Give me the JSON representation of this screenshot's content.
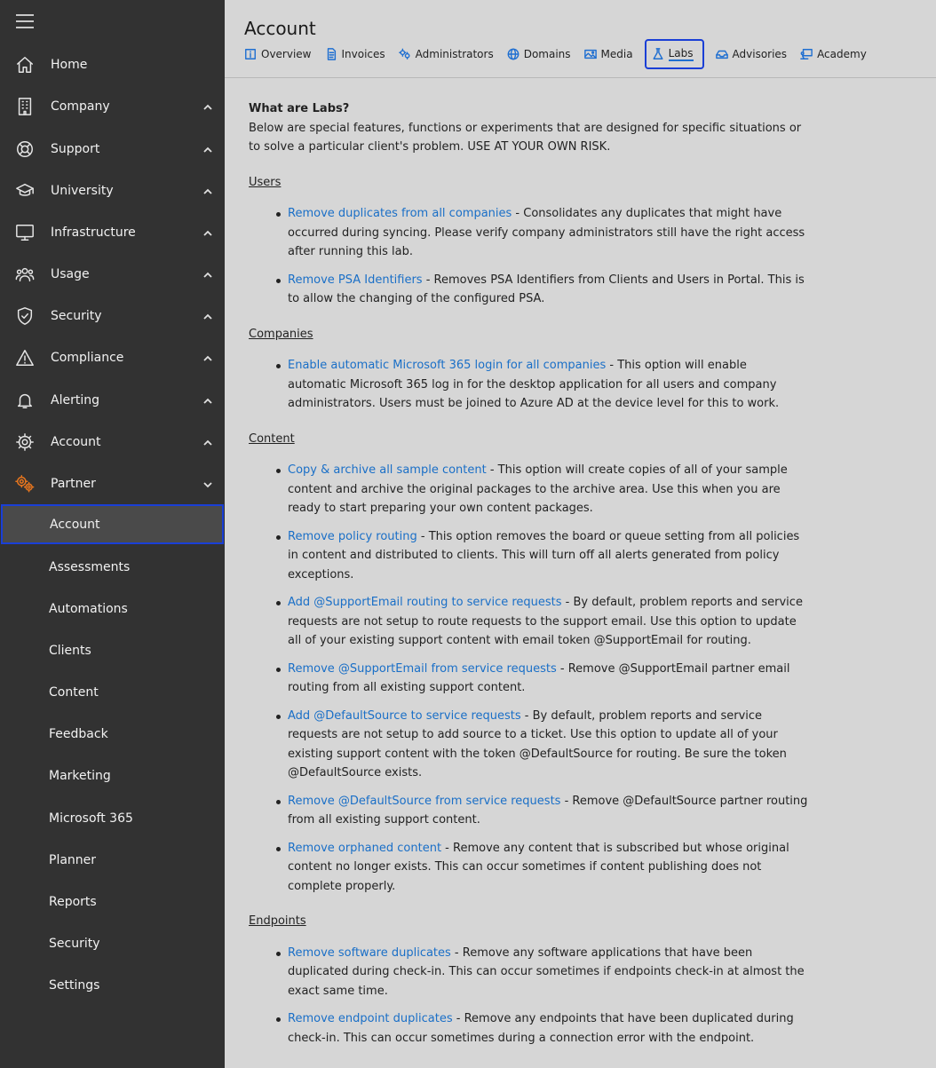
{
  "sidebar": {
    "nav": [
      {
        "label": "Home",
        "icon": "home-icon",
        "chevron": ""
      },
      {
        "label": "Company",
        "icon": "building-icon",
        "chevron": "up"
      },
      {
        "label": "Support",
        "icon": "lifebuoy-icon",
        "chevron": "up"
      },
      {
        "label": "University",
        "icon": "graduation-cap-icon",
        "chevron": "up"
      },
      {
        "label": "Infrastructure",
        "icon": "monitor-icon",
        "chevron": "up"
      },
      {
        "label": "Usage",
        "icon": "users-icon",
        "chevron": "up"
      },
      {
        "label": "Security",
        "icon": "shield-icon",
        "chevron": "up"
      },
      {
        "label": "Compliance",
        "icon": "warning-icon",
        "chevron": "up"
      },
      {
        "label": "Alerting",
        "icon": "bell-icon",
        "chevron": "up"
      },
      {
        "label": "Account",
        "icon": "gear-icon",
        "chevron": "up"
      },
      {
        "label": "Partner",
        "icon": "partner-gears-icon",
        "chevron": "down"
      }
    ],
    "sub_items": [
      "Account",
      "Assessments",
      "Automations",
      "Clients",
      "Content",
      "Feedback",
      "Marketing",
      "Microsoft 365",
      "Planner",
      "Reports",
      "Security",
      "Settings"
    ],
    "active_sub": "Account",
    "partner_icon_color": "#e8761e"
  },
  "header": {
    "title": "Account",
    "tabs": [
      {
        "label": "Overview",
        "icon": "info-icon"
      },
      {
        "label": "Invoices",
        "icon": "invoice-icon"
      },
      {
        "label": "Administrators",
        "icon": "admins-icon"
      },
      {
        "label": "Domains",
        "icon": "globe-icon"
      },
      {
        "label": "Media",
        "icon": "image-icon"
      },
      {
        "label": "Labs",
        "icon": "flask-icon"
      },
      {
        "label": "Advisories",
        "icon": "advisory-icon"
      },
      {
        "label": "Academy",
        "icon": "academy-icon"
      }
    ],
    "active_tab": "Labs"
  },
  "labs": {
    "heading": "What are Labs?",
    "intro": "Below are special features, functions or experiments that are designed for specific situations or to solve a particular client's problem. USE AT YOUR OWN RISK.",
    "sections": [
      {
        "title": "Users",
        "items": [
          {
            "link": "Remove duplicates from all companies",
            "text": " - Consolidates any duplicates that might have occurred during syncing. Please verify company administrators still have the right access after running this lab."
          },
          {
            "link": "Remove PSA Identifiers",
            "text": " - Removes PSA Identifiers from Clients and Users in Portal. This is to allow the changing of the configured PSA."
          }
        ]
      },
      {
        "title": "Companies",
        "items": [
          {
            "link": "Enable automatic Microsoft 365 login for all companies",
            "text": " - This option will enable automatic Microsoft 365 log in for the desktop application for all users and company administrators. Users must be joined to Azure AD at the device level for this to work."
          }
        ]
      },
      {
        "title": "Content",
        "items": [
          {
            "link": "Copy & archive all sample content",
            "text": " - This option will create copies of all of your sample content and archive the original packages to the archive area. Use this when you are ready to start preparing your own content packages."
          },
          {
            "link": "Remove policy routing",
            "text": " - This option removes the board or queue setting from all policies in content and distributed to clients. This will turn off all alerts generated from policy exceptions."
          },
          {
            "link": "Add @SupportEmail routing to service requests",
            "text": " - By default, problem reports and service requests are not setup to route requests to the support email. Use this option to update all of your existing support content with email token @SupportEmail for routing."
          },
          {
            "link": "Remove @SupportEmail from service requests",
            "text": " - Remove @SupportEmail partner email routing from all existing support content."
          },
          {
            "link": "Add @DefaultSource to service requests",
            "text": " - By default, problem reports and service requests are not setup to add source to a ticket. Use this option to update all of your existing support content with the token @DefaultSource for routing. Be sure the token @DefaultSource exists."
          },
          {
            "link": "Remove @DefaultSource from service requests",
            "text": " - Remove @DefaultSource partner routing from all existing support content."
          },
          {
            "link": "Remove orphaned content",
            "text": " - Remove any content that is subscribed but whose original content no longer exists. This can occur sometimes if content publishing does not complete properly."
          }
        ]
      },
      {
        "title": "Endpoints",
        "items": [
          {
            "link": "Remove software duplicates",
            "text": " - Remove any software applications that have been duplicated during check-in. This can occur sometimes if endpoints check-in at almost the exact same time."
          },
          {
            "link": "Remove endpoint duplicates",
            "text": " - Remove any endpoints that have been duplicated during check-in. This can occur sometimes during a connection error with the endpoint."
          }
        ]
      }
    ]
  },
  "colors": {
    "sidebar_bg": "#323232",
    "main_bg": "#d6d6d6",
    "link": "#1a6fc7",
    "focus_outline": "#1a3fd6"
  }
}
